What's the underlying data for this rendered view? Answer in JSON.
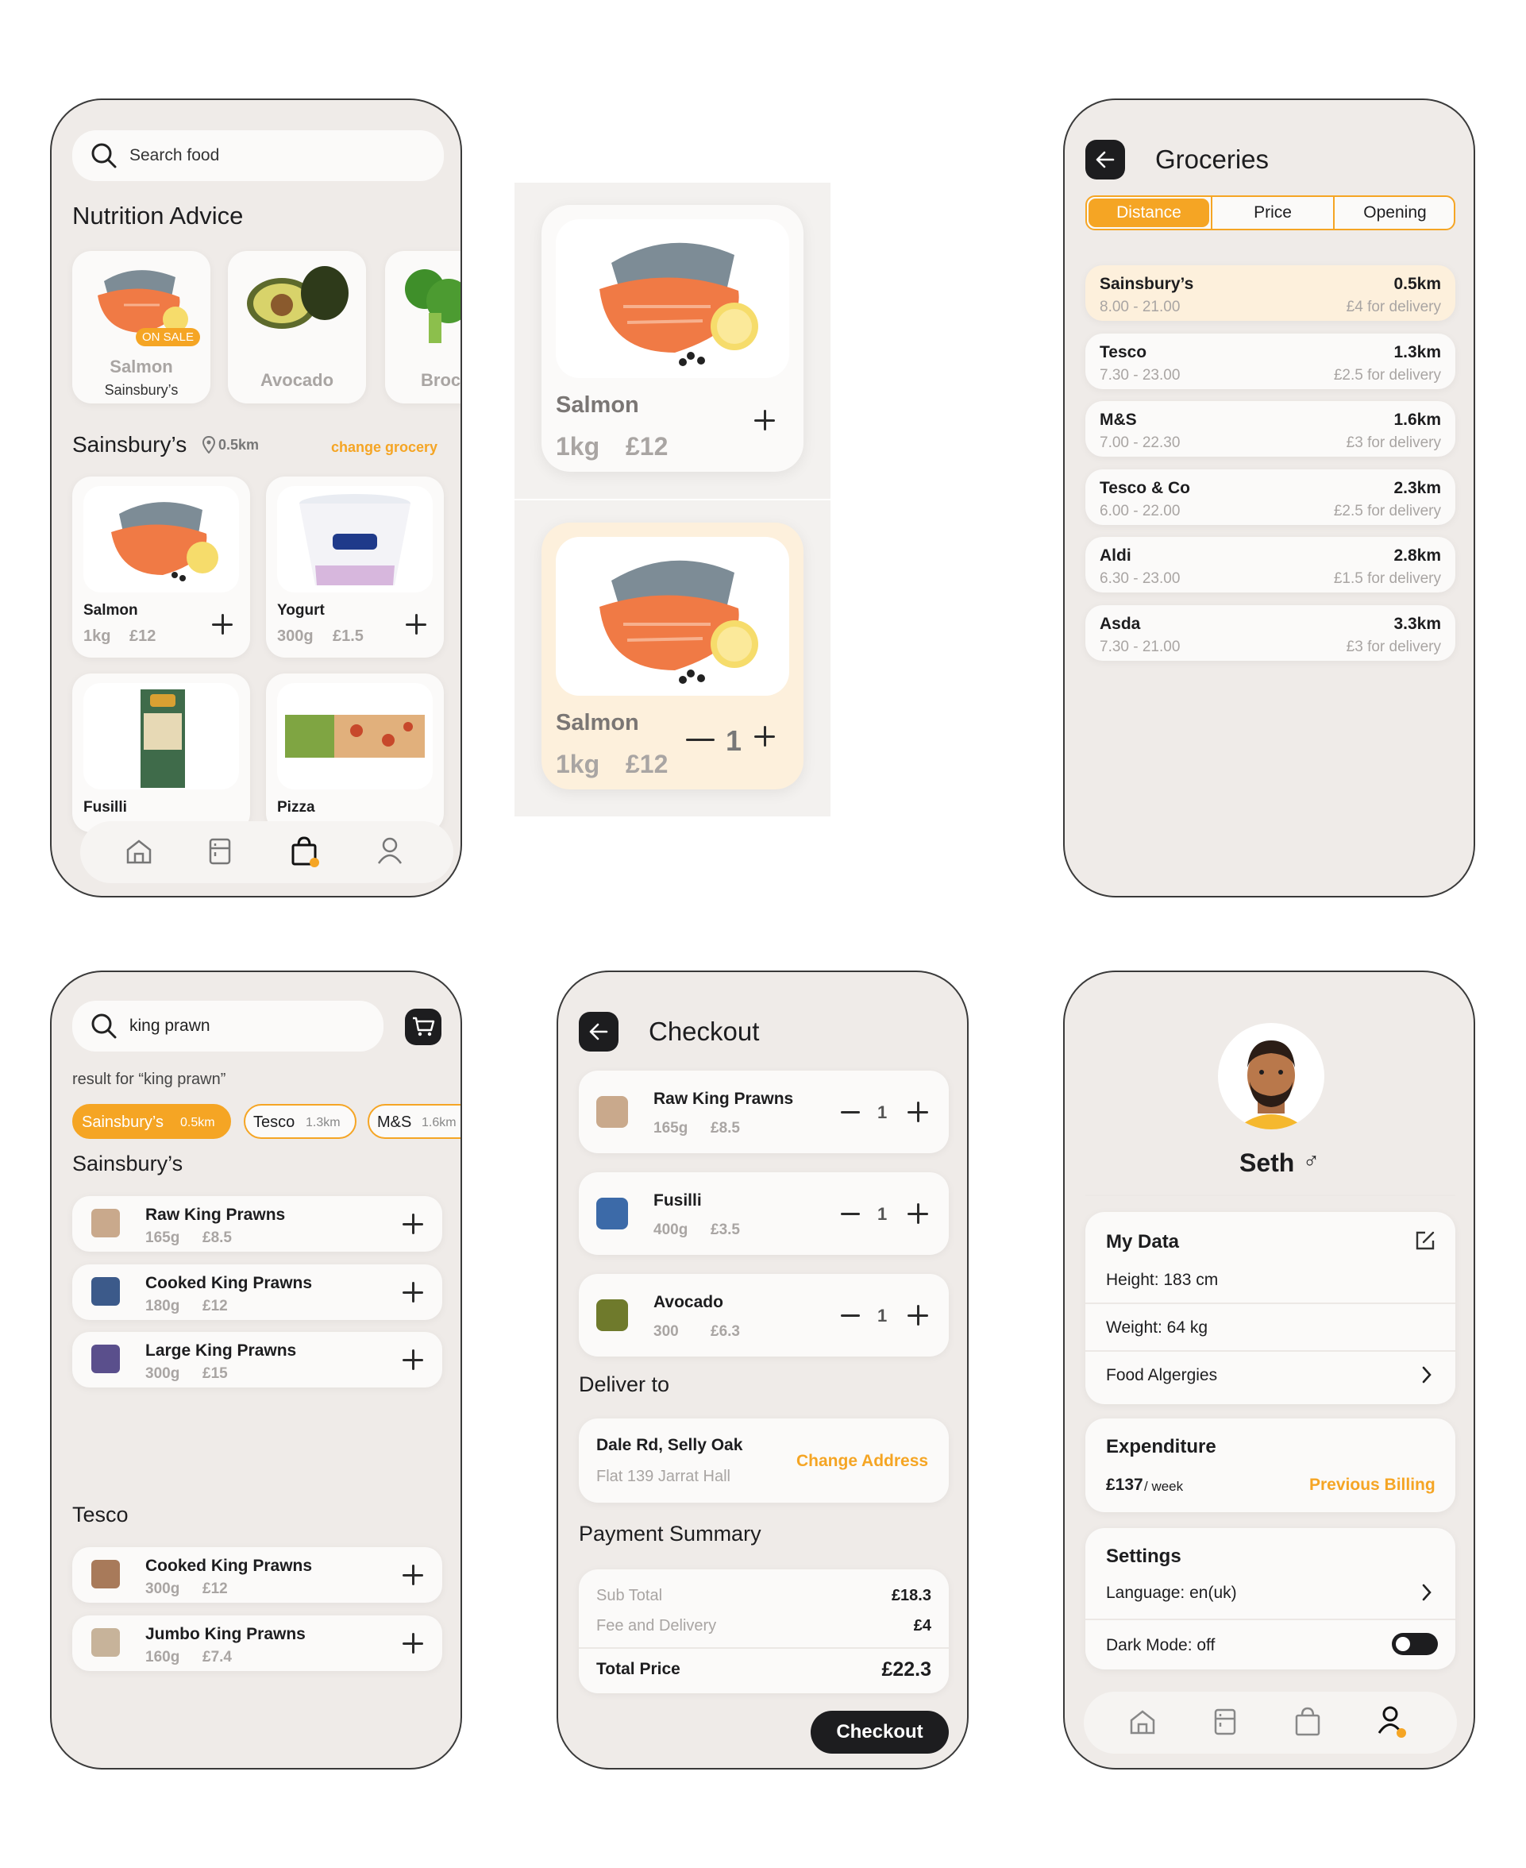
{
  "home": {
    "search_placeholder": "Search food",
    "nutrition_title": "Nutrition Advice",
    "nutrition_items": [
      {
        "name": "Salmon",
        "store": "Sainsbury’s",
        "badge": "ON SALE"
      },
      {
        "name": "Avocado"
      },
      {
        "name": "Broc"
      }
    ],
    "store_name": "Sainsbury’s",
    "store_distance": "0.5km",
    "change_grocery": "change grocery",
    "products": [
      {
        "name": "Salmon",
        "qty": "1kg",
        "price": "£12"
      },
      {
        "name": "Yogurt",
        "qty": "300g",
        "price": "£1.5"
      },
      {
        "name": "Fusilli"
      },
      {
        "name": "Pizza"
      }
    ]
  },
  "detail_cards": [
    {
      "name": "Salmon",
      "qty": "1kg",
      "price": "£12"
    },
    {
      "name": "Salmon",
      "qty": "1kg",
      "price": "£12",
      "count": "1"
    }
  ],
  "groceries": {
    "title": "Groceries",
    "tabs": [
      "Distance",
      "Price",
      "Opening"
    ],
    "active_tab": "Distance",
    "stores": [
      {
        "name": "Sainsbury’s",
        "distance": "0.5km",
        "hours": "8.00 - 21.00",
        "delivery": "£4 for delivery"
      },
      {
        "name": "Tesco",
        "distance": "1.3km",
        "hours": "7.30 - 23.00",
        "delivery": "£2.5 for delivery"
      },
      {
        "name": "M&S",
        "distance": "1.6km",
        "hours": "7.00 - 22.30",
        "delivery": "£3 for delivery"
      },
      {
        "name": "Tesco & Co",
        "distance": "2.3km",
        "hours": "6.00 - 22.00",
        "delivery": "£2.5 for delivery"
      },
      {
        "name": "Aldi",
        "distance": "2.8km",
        "hours": "6.30 - 23.00",
        "delivery": "£1.5 for delivery"
      },
      {
        "name": "Asda",
        "distance": "3.3km",
        "hours": "7.30 - 21.00",
        "delivery": "£3 for delivery"
      }
    ]
  },
  "results": {
    "search_value": "king prawn",
    "result_for": "result for “king prawn”",
    "chips": [
      {
        "name": "Sainsbury’s",
        "distance": "0.5km"
      },
      {
        "name": "Tesco",
        "distance": "1.3km"
      },
      {
        "name": "M&S",
        "distance": "1.6km"
      }
    ],
    "groups": [
      {
        "store": "Sainsbury’s",
        "items": [
          {
            "name": "Raw King Prawns",
            "qty": "165g",
            "price": "£8.5"
          },
          {
            "name": "Cooked King Prawns",
            "qty": "180g",
            "price": "£12"
          },
          {
            "name": "Large King Prawns",
            "qty": "300g",
            "price": "£15"
          }
        ]
      },
      {
        "store": "Tesco",
        "items": [
          {
            "name": "Cooked King Prawns",
            "qty": "300g",
            "price": "£12"
          },
          {
            "name": "Jumbo King Prawns",
            "qty": "160g",
            "price": "£7.4"
          }
        ]
      }
    ]
  },
  "checkout": {
    "title": "Checkout",
    "items": [
      {
        "name": "Raw King Prawns",
        "qty": "165g",
        "price": "£8.5",
        "count": "1"
      },
      {
        "name": "Fusilli",
        "qty": "400g",
        "price": "£3.5",
        "count": "1"
      },
      {
        "name": "Avocado",
        "qty": "300",
        "price": "£6.3",
        "count": "1"
      }
    ],
    "deliver_title": "Deliver to",
    "address_line1": "Dale Rd, Selly Oak",
    "address_line2": "Flat 139 Jarrat Hall",
    "change_address": "Change Address",
    "payment_title": "Payment Summary",
    "subtotal_label": "Sub Total",
    "subtotal": "£18.3",
    "fee_label": "Fee and Delivery",
    "fee": "£4",
    "total_label": "Total Price",
    "total": "£22.3",
    "button": "Checkout"
  },
  "profile": {
    "name": "Seth",
    "gender_symbol": "♂",
    "my_data_title": "My Data",
    "height": "Height: 183 cm",
    "weight": "Weight: 64 kg",
    "allergies": "Food Algergies",
    "expenditure_title": "Expenditure",
    "expenditure_value": "£137",
    "expenditure_period": " / week",
    "previous_billing": "Previous Billing",
    "settings_title": "Settings",
    "language": "Language: en(uk)",
    "dark_mode": "Dark Mode: off"
  },
  "colors": {
    "accent": "#f5a524",
    "background": "#efebe8",
    "card": "#fbfaf9",
    "dark": "#1d1d1f"
  }
}
